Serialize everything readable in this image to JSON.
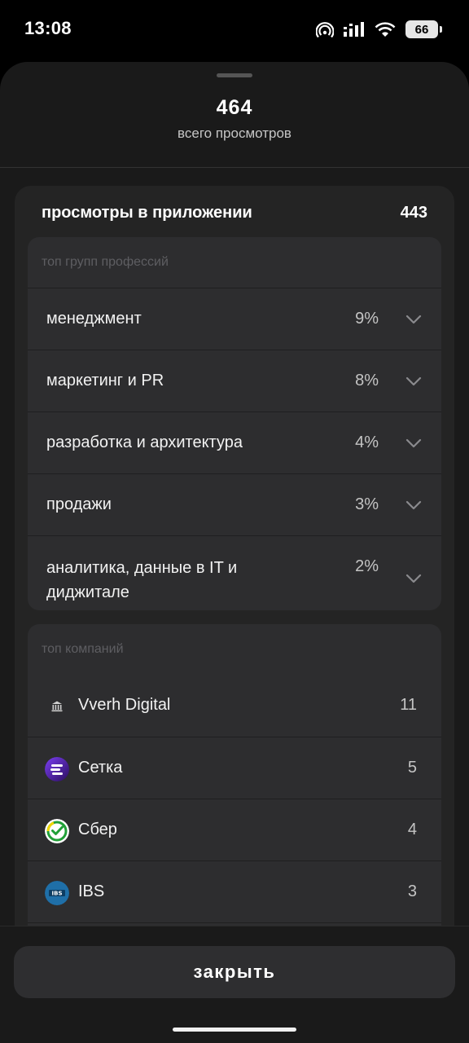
{
  "status_bar": {
    "time": "13:08",
    "battery": "66"
  },
  "summary": {
    "total_views": "464",
    "total_views_label": "всего просмотров"
  },
  "app_views": {
    "title": "просмотры в приложении",
    "count": "443",
    "professions": {
      "title": "топ групп профессий",
      "items": [
        {
          "name": "менеджмент",
          "percent": "9%"
        },
        {
          "name": "маркетинг и PR",
          "percent": "8%"
        },
        {
          "name": "разработка и архитектура",
          "percent": "4%"
        },
        {
          "name": "продажи",
          "percent": "3%"
        },
        {
          "name": "аналитика, данные в IT и диджитале",
          "percent": "2%"
        }
      ]
    },
    "companies": {
      "title": "топ компаний",
      "items": [
        {
          "name": "Vverh Digital",
          "count": "11",
          "icon": "bank-icon"
        },
        {
          "name": "Сетка",
          "count": "5",
          "icon": "setka-logo-icon"
        },
        {
          "name": "Сбер",
          "count": "4",
          "icon": "sber-logo-icon"
        },
        {
          "name": "IBS",
          "count": "3",
          "icon": "ibs-logo-icon",
          "icon_text": "IBS"
        }
      ]
    }
  },
  "footer": {
    "close_label": "закрыть"
  },
  "colors": {
    "sheet": "#1a1a1a",
    "card": "#242424",
    "subcard": "#2d2d2f",
    "button": "#2e2e30"
  }
}
